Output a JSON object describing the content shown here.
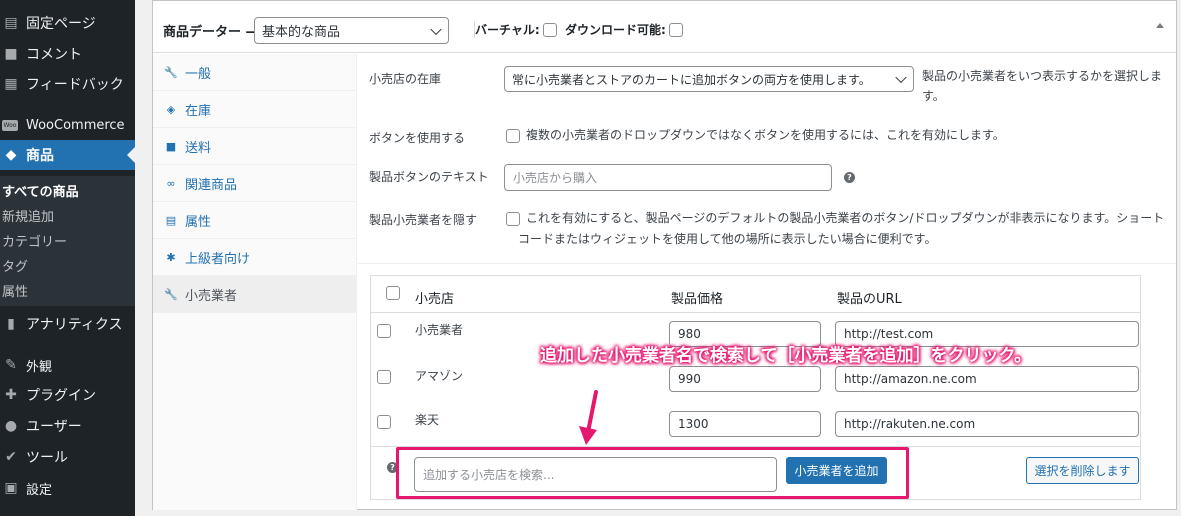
{
  "sidebar": {
    "items": [
      {
        "label": "固定ページ",
        "icon": "page-icon"
      },
      {
        "label": "コメント",
        "icon": "comment-icon"
      },
      {
        "label": "フィードバック",
        "icon": "feedback-icon"
      },
      {
        "label": "WooCommerce",
        "icon": "woo-icon"
      },
      {
        "label": "商品",
        "icon": "product-icon"
      },
      {
        "label": "アナリティクス",
        "icon": "analytics-icon"
      },
      {
        "label": "外観",
        "icon": "appearance-icon"
      },
      {
        "label": "プラグイン",
        "icon": "plugin-icon"
      },
      {
        "label": "ユーザー",
        "icon": "user-icon"
      },
      {
        "label": "ツール",
        "icon": "tool-icon"
      },
      {
        "label": "設定",
        "icon": "settings-icon"
      }
    ],
    "woo_badge": "Woo",
    "submenu": [
      "すべての商品",
      "新規追加",
      "カテゴリー",
      "タグ",
      "属性"
    ]
  },
  "metabox": {
    "title": "商品データー —",
    "product_type": "基本的な商品",
    "virtual_label": "バーチャル:",
    "downloadable_label": "ダウンロード可能:"
  },
  "tabs": [
    {
      "label": "一般",
      "icon": "wrench-icon"
    },
    {
      "label": "在庫",
      "icon": "tag-icon"
    },
    {
      "label": "送料",
      "icon": "truck-icon"
    },
    {
      "label": "関連商品",
      "icon": "link-icon"
    },
    {
      "label": "属性",
      "icon": "list-icon"
    },
    {
      "label": "上級者向け",
      "icon": "gear-icon"
    },
    {
      "label": "小売業者",
      "icon": "wrench-icon"
    }
  ],
  "panel": {
    "stock_label": "小売店の在庫",
    "stock_select": "常に小売業者とストアのカートに追加ボタンの両方を使用します。",
    "stock_desc_1": "製品の小売業者をいつ表示するかを選択しま",
    "stock_desc_2": "す。",
    "button_label": "ボタンを使用する",
    "button_desc": "複数の小売業者のドロップダウンではなくボタンを使用するには、これを有効にします。",
    "text_label": "製品ボタンのテキスト",
    "text_placeholder": "小売店から購入",
    "hide_label": "製品小売業者を隠す",
    "hide_desc_1": "これを有効にすると、製品ページのデフォルトの製品小売業者のボタン/ドロップダウンが非表示になります。ショート",
    "hide_desc_2": "コードまたはウィジェットを使用して他の場所に表示したい場合に便利です。"
  },
  "retailers": {
    "headers": {
      "name": "小売店",
      "price": "製品価格",
      "url": "製品のURL"
    },
    "rows": [
      {
        "name": "小売業者",
        "price": "980",
        "url": "http://test.com"
      },
      {
        "name": "アマゾン",
        "price": "990",
        "url": "http://amazon.ne.com"
      },
      {
        "name": "楽天",
        "price": "1300",
        "url": "http://rakuten.ne.com"
      }
    ],
    "search_placeholder": "追加する小売店を検索...",
    "add_button": "小売業者を追加",
    "remove_button": "選択を削除します"
  },
  "annotation": {
    "text": "追加した小売業者名で検索して［小売業者を追加］をクリック。",
    "color": "#e6176f"
  }
}
